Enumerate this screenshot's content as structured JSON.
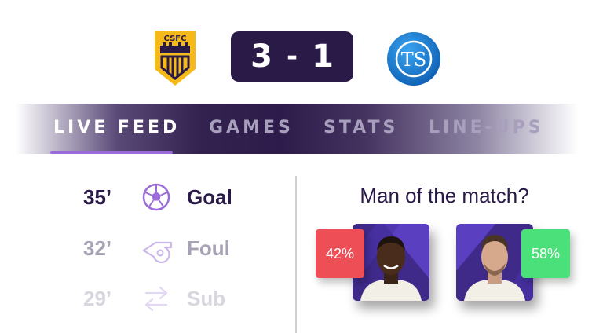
{
  "match": {
    "home_team": {
      "crest_text": "CSFC",
      "crest_color": "#f6b91a"
    },
    "away_team": {
      "crest_text": "TS",
      "crest_color": "#1e7fd6"
    },
    "score": {
      "home": "3",
      "separator": "-",
      "away": "1"
    }
  },
  "tabs": [
    {
      "label": "LIVE FEED",
      "active": true
    },
    {
      "label": "GAMES",
      "active": false
    },
    {
      "label": "STATS",
      "active": false
    },
    {
      "label": "LINE-UPS",
      "active": false
    }
  ],
  "feed": [
    {
      "minute": "35’",
      "event": "Goal",
      "icon": "football-icon"
    },
    {
      "minute": "32’",
      "event": "Foul",
      "icon": "whistle-icon"
    },
    {
      "minute": "29’",
      "event": "Sub",
      "icon": "substitution-icon"
    }
  ],
  "motm": {
    "title": "Man of the match?",
    "players": [
      {
        "percent": "42%",
        "percent_color": "#ee4e55"
      },
      {
        "percent": "58%",
        "percent_color": "#4be07a"
      }
    ]
  },
  "colors": {
    "primary_dark": "#2a1a48",
    "accent_purple": "#9b6cd9"
  }
}
